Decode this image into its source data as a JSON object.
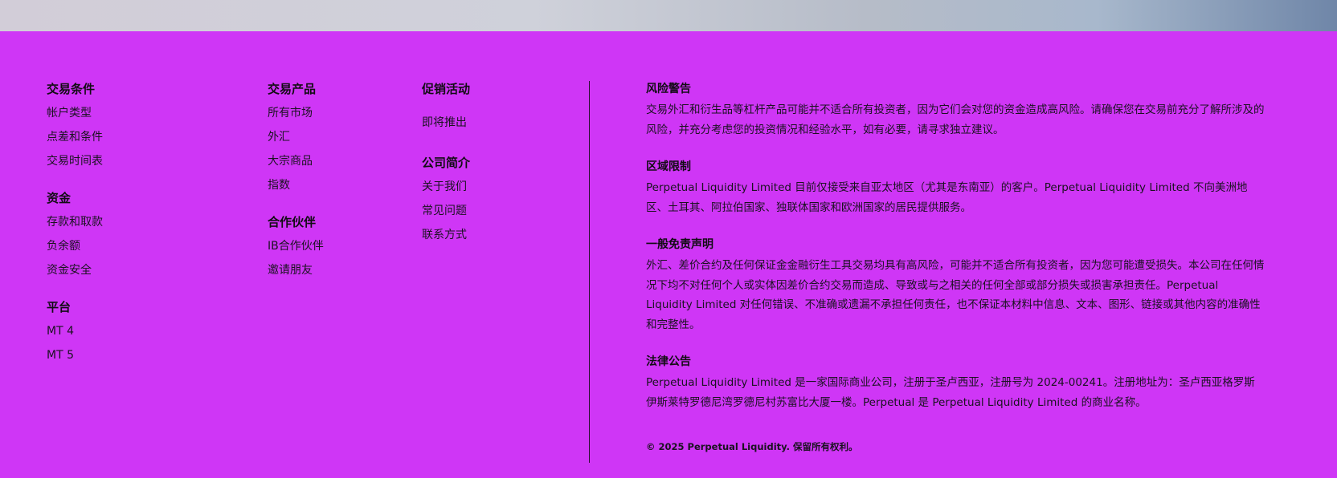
{
  "footer": {
    "columns": [
      {
        "groups": [
          {
            "title": "交易条件",
            "links": [
              "帐户类型",
              "点差和条件",
              "交易时间表"
            ]
          },
          {
            "title": "资金",
            "links": [
              "存款和取款",
              "负余额",
              "资金安全"
            ]
          },
          {
            "title": "平台",
            "links": [
              "MT 4",
              "MT 5"
            ]
          }
        ]
      },
      {
        "groups": [
          {
            "title": "交易产品",
            "links": [
              "所有市场",
              "外汇",
              "大宗商品",
              "指数"
            ]
          },
          {
            "title": "合作伙伴",
            "links": [
              "IB合作伙伴",
              "邀请朋友"
            ]
          }
        ]
      },
      {
        "groups": [
          {
            "title": "促销活动",
            "links": [
              "即将推出"
            ]
          },
          {
            "title": "公司简介",
            "links": [
              "关于我们",
              "常见问题",
              "联系方式"
            ]
          }
        ]
      }
    ],
    "legal": [
      {
        "title": "风险警告",
        "text": "交易外汇和衍生品等杠杆产品可能并不适合所有投资者，因为它们会对您的资金造成高风险。请确保您在交易前充分了解所涉及的风险，并充分考虑您的投资情况和经验水平，如有必要，请寻求独立建议。"
      },
      {
        "title": "区域限制",
        "text": "Perpetual Liquidity Limited 目前仅接受来自亚太地区（尤其是东南亚）的客户。Perpetual Liquidity Limited 不向美洲地区、土耳其、阿拉伯国家、独联体国家和欧洲国家的居民提供服务。"
      },
      {
        "title": "一般免责声明",
        "text": "外汇、差价合约及任何保证金金融衍生工具交易均具有高风险，可能并不适合所有投资者，因为您可能遭受损失。本公司在任何情况下均不对任何个人或实体因差价合约交易而造成、导致或与之相关的任何全部或部分损失或损害承担责任。Perpetual Liquidity Limited 对任何错误、不准确或遗漏不承担任何责任，也不保证本材料中信息、文本、图形、链接或其他内容的准确性和完整性。"
      },
      {
        "title": "法律公告",
        "text": "Perpetual Liquidity Limited 是一家国际商业公司，注册于圣卢西亚，注册号为 2024-00241。注册地址为：圣卢西亚格罗斯伊斯莱特罗德尼湾罗德尼村苏富比大厦一楼。Perpetual 是 Perpetual Liquidity Limited 的商业名称。"
      }
    ],
    "copyright": "© 2025 Perpetual Liquidity. 保留所有权利。"
  },
  "colors": {
    "footer_bg": "#cf36f6",
    "text": "#161016"
  }
}
